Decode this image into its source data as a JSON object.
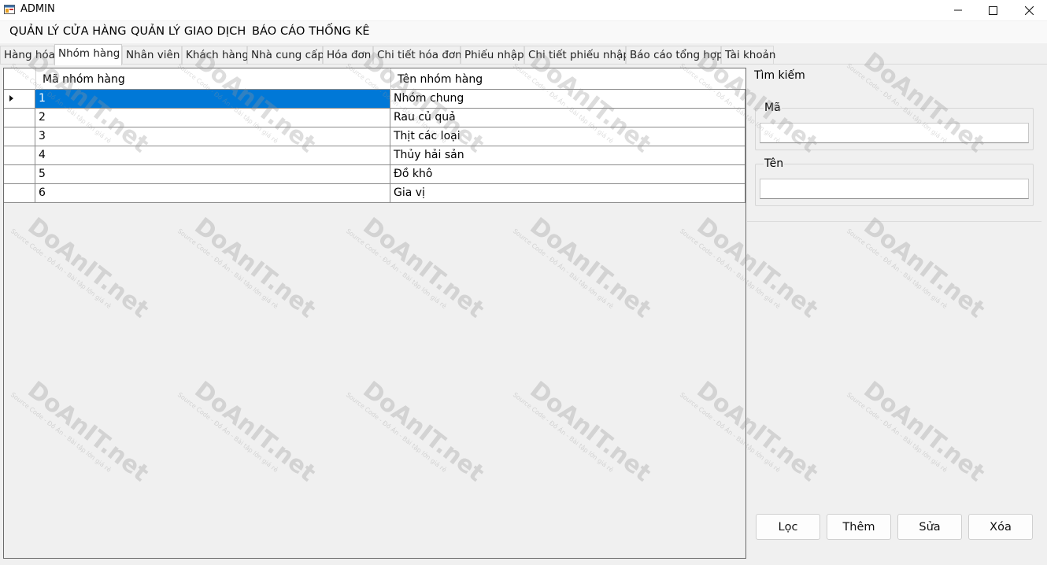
{
  "window": {
    "title": "ADMIN"
  },
  "menu": [
    "QUẢN LÝ CỬA HÀNG",
    "QUẢN LÝ GIAO DỊCH",
    "BÁO CÁO THỐNG KÊ"
  ],
  "tabs": [
    "Hàng hóa",
    "Nhóm hàng",
    "Nhân viên",
    "Khách hàng",
    "Nhà cung cấp",
    "Hóa đơn",
    "Chi tiết hóa đơn",
    "Phiếu nhập",
    "Chi tiết phiếu nhập",
    "Báo cáo tổng hợp",
    "Tài khoản"
  ],
  "active_tab": "Nhóm hàng",
  "grid": {
    "columns": [
      "Mã nhóm hàng",
      "Tên nhóm hàng"
    ],
    "rows": [
      [
        "1",
        "Nhóm chung"
      ],
      [
        "2",
        "Rau củ quả"
      ],
      [
        "3",
        "Thịt các loại"
      ],
      [
        "4",
        "Thủy hải sản"
      ],
      [
        "5",
        "Đồ khô"
      ],
      [
        "6",
        "Gia vị"
      ]
    ],
    "selected_row": 0
  },
  "search": {
    "title": "Tìm kiếm",
    "ma_label": "Mã",
    "ma_value": "",
    "ten_label": "Tên",
    "ten_value": ""
  },
  "buttons": {
    "filter": "Lọc",
    "add": "Thêm",
    "edit": "Sửa",
    "delete": "Xóa"
  },
  "watermark": {
    "brand": "DoAnIT.net",
    "tagline": "Source Code - Đồ Án - Bài tập lớn giá rẻ"
  },
  "colors": {
    "selection": "#0078d7",
    "background": "#f0f0f0"
  }
}
